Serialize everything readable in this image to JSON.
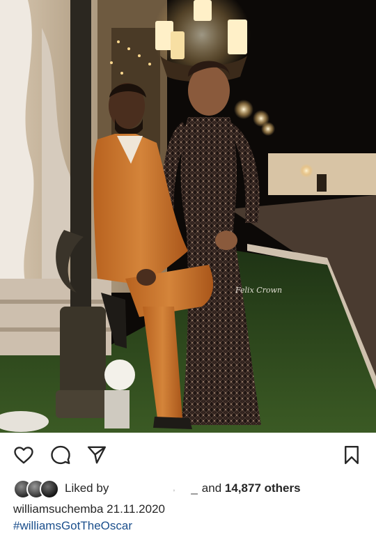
{
  "post": {
    "liked_by_label": "Liked by",
    "liked_by_masked": ",",
    "liked_by_dash": "_",
    "and_label": "and",
    "likes_count": "14,877 others",
    "username": "williamsuchemba",
    "date": "21.11.2020",
    "hashtag": "#williamsGotTheOscar",
    "watermark": "Felix Crown"
  },
  "icons": {
    "like": "heart-icon",
    "comment": "comment-icon",
    "share": "send-icon",
    "save": "bookmark-icon"
  },
  "colors": {
    "text": "#262626",
    "hashtag": "#1b4f8c",
    "suit": "#c2712a",
    "dress": "#2a1c18",
    "lawn": "#2f4a1f"
  }
}
